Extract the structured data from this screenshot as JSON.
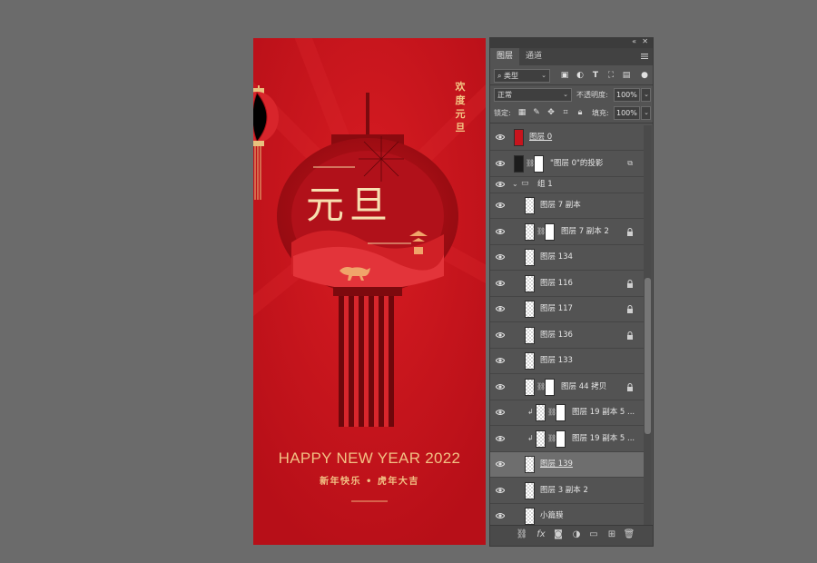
{
  "poster": {
    "vertical_title": "欢\n度\n元\n旦",
    "big_title": "元旦",
    "headline": "HAPPY NEW YEAR 2022",
    "subtitle": "新年快乐 • 虎年大吉"
  },
  "panel": {
    "tabs": [
      {
        "label": "图层",
        "active": true
      },
      {
        "label": "通道",
        "active": false
      }
    ],
    "filter_label": "类型",
    "blend_mode": "正常",
    "opacity_label": "不透明度:",
    "opacity_value": "100%",
    "lock_label": "锁定:",
    "fill_label": "填充:",
    "fill_value": "100%",
    "icons": [
      "search-icon",
      "image-filter-icon",
      "adjustment-filter-icon",
      "type-filter-icon",
      "shape-filter-icon",
      "smart-object-filter-icon",
      "toggle-filter-icon"
    ],
    "lock_icons": [
      "lock-transparent-icon",
      "lock-image-icon",
      "lock-position-icon",
      "lock-artboard-icon",
      "lock-all-icon"
    ],
    "layers": [
      {
        "name": "图层 0",
        "thumb": "red",
        "mask": false,
        "lock": false,
        "indent": 0,
        "underline": true
      },
      {
        "name": "\"图层 0\"的投影",
        "thumb": "dark",
        "mask": true,
        "lock": false,
        "indent": 0,
        "fxicon": true
      },
      {
        "name": "组 1",
        "group": true
      },
      {
        "name": "图层 7 副本",
        "thumb": "check",
        "mask": false,
        "lock": false,
        "indent": 1
      },
      {
        "name": "图层 7 副本 2",
        "thumb": "check",
        "mask": true,
        "lock": true,
        "indent": 1
      },
      {
        "name": "图层 134",
        "thumb": "check",
        "mask": false,
        "lock": false,
        "indent": 1
      },
      {
        "name": "图层 116",
        "thumb": "check",
        "mask": false,
        "lock": true,
        "indent": 1
      },
      {
        "name": "图层 117",
        "thumb": "check",
        "mask": false,
        "lock": true,
        "indent": 1
      },
      {
        "name": "图层 136",
        "thumb": "check",
        "mask": false,
        "lock": true,
        "indent": 1
      },
      {
        "name": "图层 133",
        "thumb": "check",
        "mask": false,
        "lock": false,
        "indent": 1
      },
      {
        "name": "图层 44 拷贝",
        "thumb": "check",
        "mask": true,
        "lock": true,
        "indent": 1
      },
      {
        "name": "图层 19 副本 5 ...",
        "thumb": "check",
        "mask": true,
        "lock": false,
        "indent": 2,
        "clip": true
      },
      {
        "name": "图层 19 副本 5 ...",
        "thumb": "check",
        "mask": true,
        "lock": false,
        "indent": 2,
        "clip": true
      },
      {
        "name": "图层 139",
        "thumb": "check",
        "mask": false,
        "lock": false,
        "indent": 1,
        "selected": true,
        "underline": true
      },
      {
        "name": "图层 3 副本 2",
        "thumb": "check",
        "mask": false,
        "lock": false,
        "indent": 1
      },
      {
        "name": "小篇膜",
        "thumb": "check",
        "mask": false,
        "lock": false,
        "indent": 1
      }
    ],
    "bottom_icons": [
      "link-layers-icon",
      "fx-icon",
      "add-mask-icon",
      "adjustment-layer-icon",
      "new-group-icon",
      "new-layer-icon",
      "delete-layer-icon"
    ]
  }
}
